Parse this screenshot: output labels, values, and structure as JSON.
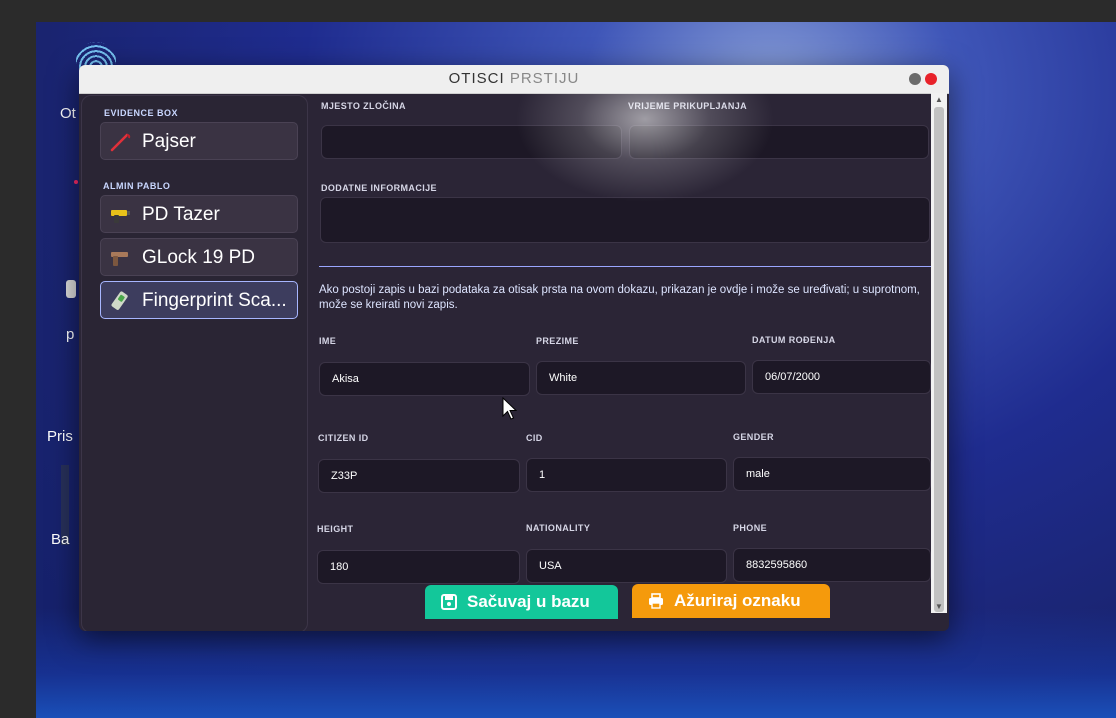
{
  "desktop": {
    "labels": [
      "Ot",
      "p",
      "Pris",
      "Ba"
    ]
  },
  "window": {
    "title_primary": "OTISCI",
    "title_secondary": "PRSTIJU"
  },
  "sidebar": {
    "groups": [
      {
        "label": "EVIDENCE BOX",
        "items": [
          {
            "label": "Pajser",
            "icon": "crowbar-icon"
          }
        ]
      },
      {
        "label": "ALMIN PABLO",
        "items": [
          {
            "label": "PD Tazer",
            "icon": "taser-icon"
          },
          {
            "label": "GLock 19 PD",
            "icon": "pistol-icon"
          },
          {
            "label": "Fingerprint Sca...",
            "icon": "fingerprint-scanner-icon",
            "active": true
          }
        ]
      }
    ]
  },
  "evidence": {
    "crime_location_label": "MJESTO ZLOČINA",
    "collection_time_label": "VRIJEME PRIKUPLJANJA",
    "additional_info_label": "DODATNE INFORMACIJE",
    "crime_location_value": "",
    "collection_time_value": "",
    "additional_info_value": ""
  },
  "info_text": "Ako postoji zapis u bazi podataka za otisak prsta na ovom dokazu, prikazan je ovdje i može se uređivati; u suprotnom, može se kreirati novi zapis.",
  "record": {
    "first_name_label": "IME",
    "first_name": "Akisa",
    "last_name_label": "PREZIME",
    "last_name": "White",
    "dob_label": "DATUM ROĐENJA",
    "dob": "06/07/2000",
    "citizen_id_label": "CITIZEN ID",
    "citizen_id": "Z33P",
    "cid_label": "CID",
    "cid": "1",
    "gender_label": "GENDER",
    "gender": "male",
    "height_label": "HEIGHT",
    "height": "180",
    "nationality_label": "NATIONALITY",
    "nationality": "USA",
    "phone_label": "PHONE",
    "phone": "8832595860"
  },
  "actions": {
    "save_label": "Sačuvaj u bazu",
    "update_label": "Ažuriraj oznaku"
  },
  "colors": {
    "save": "#13c79a",
    "update": "#f59a0c",
    "active_border": "#a7b6ff",
    "close": "#e8222a"
  }
}
